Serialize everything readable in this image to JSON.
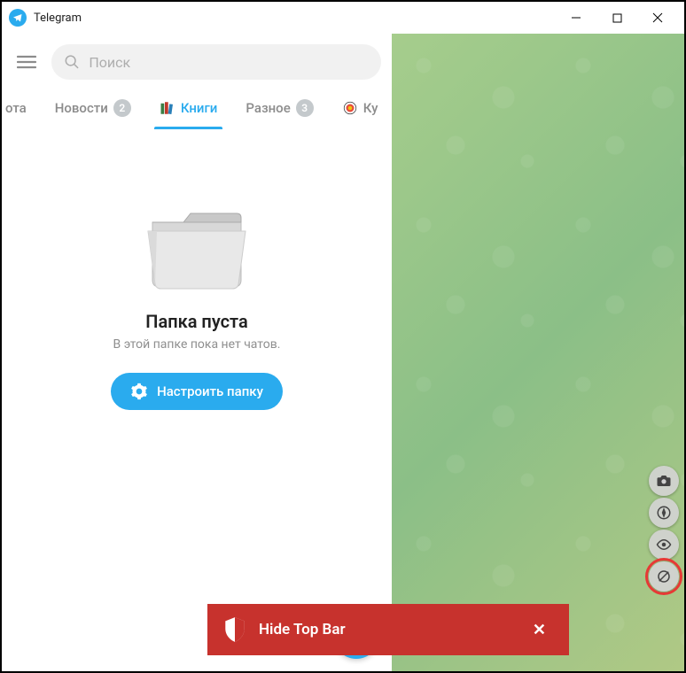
{
  "app": {
    "title": "Telegram"
  },
  "search": {
    "placeholder": "Поиск"
  },
  "tabs": [
    {
      "label": "ота",
      "badge": null,
      "icon": null
    },
    {
      "label": "Новости",
      "badge": "2",
      "icon": null
    },
    {
      "label": "Книги",
      "badge": null,
      "icon": "books",
      "active": true
    },
    {
      "label": "Разное",
      "badge": "3",
      "icon": null
    },
    {
      "label": "Ку",
      "badge": null,
      "icon": "target"
    }
  ],
  "empty": {
    "title": "Папка пуста",
    "subtitle": "В этой папке пока нет чатов.",
    "button": "Настроить папку"
  },
  "hidebar": {
    "text": "Hide Top Bar",
    "close": "✕"
  },
  "tools": [
    "camera",
    "compass",
    "eye",
    "crossed"
  ]
}
